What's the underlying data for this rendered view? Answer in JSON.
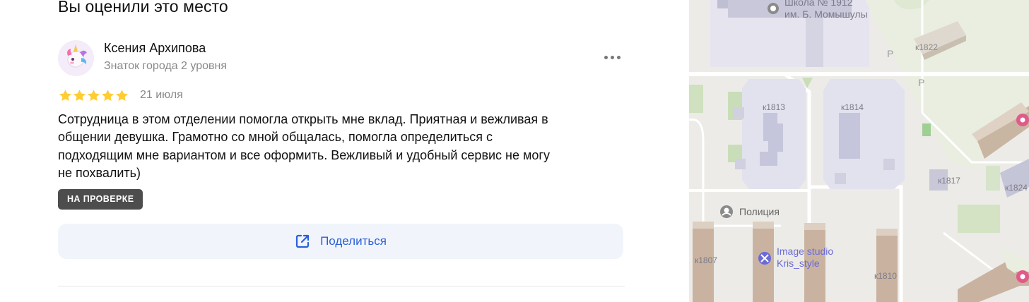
{
  "header": {
    "title": "Вы оценили это место"
  },
  "review": {
    "author": "Ксения Архипова",
    "author_level": "Знаток города 2 уровня",
    "rating": 5,
    "rating_max": 5,
    "date": "21 июля",
    "text_lines": [
      "Сотрудница в этом отделении помогла открыть мне вклад. Приятная и вежливая в",
      "общении девушка. Грамотно со мной общалась, помогла определиться с",
      "подходящим мне вариантом и все оформить. Вежливый и удобный сервис не могу",
      "не похвалить)"
    ],
    "status_badge": "НА ПРОВЕРКЕ",
    "share_label": "Поделиться"
  },
  "map": {
    "labels": {
      "school_line1": "Школа № 1912",
      "school_line2": "им. Б. Момышулы",
      "k1822": "к1822",
      "k1813": "к1813",
      "k1814": "к1814",
      "k1817": "к1817",
      "k1824": "к1824",
      "police": "Полиция",
      "k1807": "к1807",
      "studio_line1": "Image studio",
      "studio_line2": "Kris_style",
      "k1810": "к1810",
      "parking1": "P",
      "parking2": "P"
    }
  },
  "colors": {
    "star": "#fc3",
    "accent": "#2a5fd8",
    "badge_bg": "#4d4d4d",
    "share_bg": "#f1f5fb",
    "map_poi_purple": "#6a6ad8"
  },
  "icons": {
    "avatar": "unicorn-avatar",
    "more": "more-dots-icon",
    "star": "star-icon",
    "share": "external-share-icon",
    "school": "school-icon",
    "police": "police-icon",
    "studio": "scissors-icon",
    "beauty": "beauty-pin-icon"
  }
}
